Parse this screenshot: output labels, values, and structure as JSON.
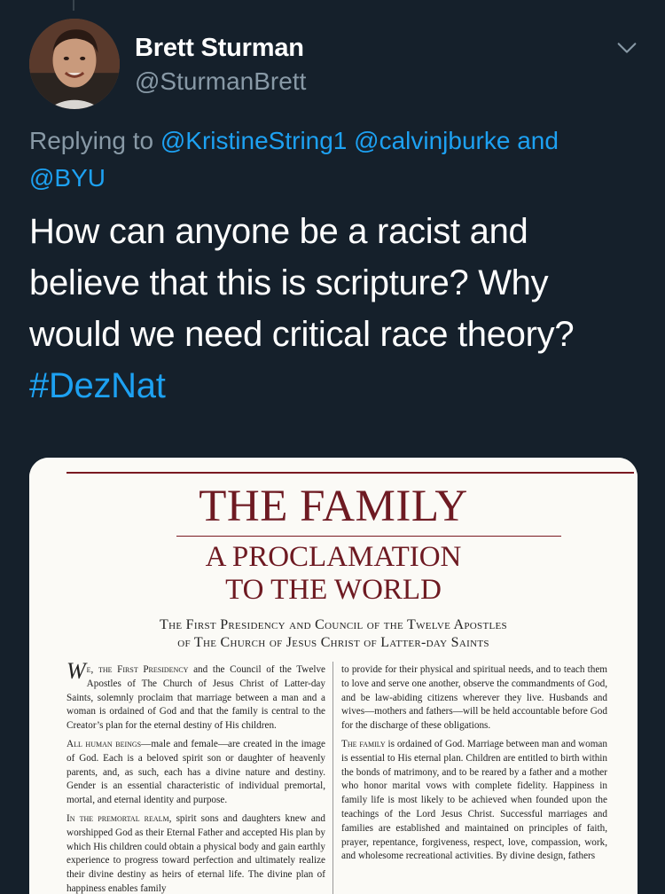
{
  "author": {
    "display_name": "Brett Sturman",
    "handle": "@SturmanBrett"
  },
  "reply": {
    "prefix": "Replying to",
    "mentions": [
      "@KristineString1",
      "@calvinjburke",
      "@BYU"
    ],
    "conjunction": "and"
  },
  "tweet": {
    "text": "How can anyone be a racist and believe that this is scripture? Why would we need critical race theory?",
    "hashtag": "#DezNat"
  },
  "document": {
    "title": "THE FAMILY",
    "subtitle_line1": "A PROCLAMATION",
    "subtitle_line2": "TO THE WORLD",
    "authors_line1": "The First Presidency and Council of the Twelve Apostles",
    "authors_line2": "of The Church of Jesus Christ of Latter-day Saints",
    "left_p1_dropcap": "W",
    "left_p1_lead": "e, the First Presidency",
    "left_p1_rest": " and the Council of the Twelve Apostles of The Church of Jesus Christ of Latter-day Saints, solemnly proclaim that marriage between a man and a woman is ordained of God and that the family is central to the Creator’s plan for the eternal destiny of His children.",
    "left_p2_lead": "All human beings",
    "left_p2_rest": "—male and female—are created in the image of God. Each is a beloved spirit son or daughter of heavenly parents, and, as such, each has a divine nature and destiny. Gender is an essential characteristic of individual premortal, mortal, and eternal identity and purpose.",
    "left_p3_lead": "In the premortal realm,",
    "left_p3_rest": " spirit sons and daughters knew and worshipped God as their Eternal Father and accepted His plan by which His children could obtain a physical body and gain earthly experience to progress toward perfection and ultimately realize their divine destiny as heirs of eternal life. The divine plan of happiness enables family",
    "right_p1": "to provide for their physical and spiritual needs, and to teach them to love and serve one another, observe the commandments of God, and be law-abiding citizens wherever they live. Husbands and wives—mothers and fathers—will be held accountable before God for the discharge of these obligations.",
    "right_p2_lead": "The family",
    "right_p2_rest": " is ordained of God. Marriage between man and woman is essential to His eternal plan. Children are entitled to birth within the bonds of matrimony, and to be reared by a father and a mother who honor marital vows with complete fidelity. Happiness in family life is most likely to be achieved when founded upon the teachings of the Lord Jesus Christ. Successful marriages and families are established and maintained on principles of faith, prayer, repentance, forgiveness, respect, love, compassion, work, and wholesome recreational activities. By divine design, fathers"
  },
  "icons": {
    "more": "chevron-down-icon"
  },
  "colors": {
    "background": "#15202b",
    "link": "#1da1f2",
    "secondary_text": "#8899a6",
    "doc_title": "#6e1a22"
  }
}
